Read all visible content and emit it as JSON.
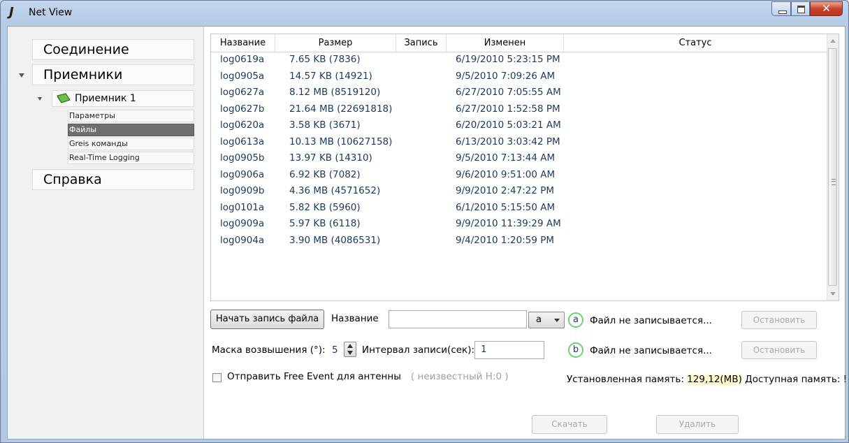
{
  "window": {
    "title": "Net View"
  },
  "sidebar": {
    "sections": [
      "Соединение",
      "Приемники",
      "Справка"
    ],
    "receiver": "Приемник 1",
    "subitems": [
      "Параметры",
      "Файлы",
      "Greis команды",
      "Real-Time Logging"
    ],
    "selected_subitem": "Файлы"
  },
  "table": {
    "columns": [
      "Название",
      "Размер",
      "Запись",
      "Изменен",
      "Статус"
    ],
    "rows": [
      [
        "log0619a",
        "7.65 KB (7836)",
        "",
        "6/19/2010 5:23:15 PM",
        ""
      ],
      [
        "log0905a",
        "14.57 KB (14921)",
        "",
        "9/5/2010 7:09:26 AM",
        ""
      ],
      [
        "log0627a",
        "8.12 MB (8519120)",
        "",
        "6/27/2010 7:05:55 AM",
        ""
      ],
      [
        "log0627b",
        "21.64 MB (22691818)",
        "",
        "6/27/2010 1:52:58 PM",
        ""
      ],
      [
        "log0620a",
        "3.58 KB (3671)",
        "",
        "6/20/2010 5:03:21 AM",
        ""
      ],
      [
        "log0613a",
        "10.13 MB (10627158)",
        "",
        "6/13/2010 3:03:42 PM",
        ""
      ],
      [
        "log0905b",
        "13.97 KB (14310)",
        "",
        "9/5/2010 7:13:44 AM",
        ""
      ],
      [
        "log0906a",
        "6.92 KB (7082)",
        "",
        "9/6/2010 9:51:00 AM",
        ""
      ],
      [
        "log0909b",
        "4.36 MB (4571652)",
        "",
        "9/9/2010 2:47:22 PM",
        ""
      ],
      [
        "log0101a",
        "5.82 KB (5960)",
        "",
        "6/1/2010 5:15:50 AM",
        ""
      ],
      [
        "log0909a",
        "5.97 KB (6118)",
        "",
        "9/9/2010 11:39:29 AM",
        ""
      ],
      [
        "log0904a",
        "3.90 MB (4086531)",
        "",
        "9/4/2010 1:20:59 PM",
        ""
      ]
    ]
  },
  "controls": {
    "start_button": "Начать запись файла",
    "name_label": "Название",
    "name_value": "",
    "channel_value": "a",
    "channel_a": {
      "letter": "a",
      "status": "Файл не записывается...",
      "stop": "Остановить"
    },
    "channel_b": {
      "letter": "b",
      "status": "Файл не записывается...",
      "stop": "Остановить"
    },
    "elevation_label": "Маска возвышения (°):",
    "elevation_value": "5",
    "interval_label": "Интервал записи(сек):",
    "interval_value": "1",
    "free_event_label": "Отправить Free Event для антенны",
    "antenna_info": "( неизвестный H:0 )",
    "memory_installed_label": "Установленная память:",
    "memory_installed_value": "129,12(MB)",
    "memory_available_label": "Доступная память: !",
    "download_button": "Скачать",
    "delete_button": "Удалить"
  }
}
